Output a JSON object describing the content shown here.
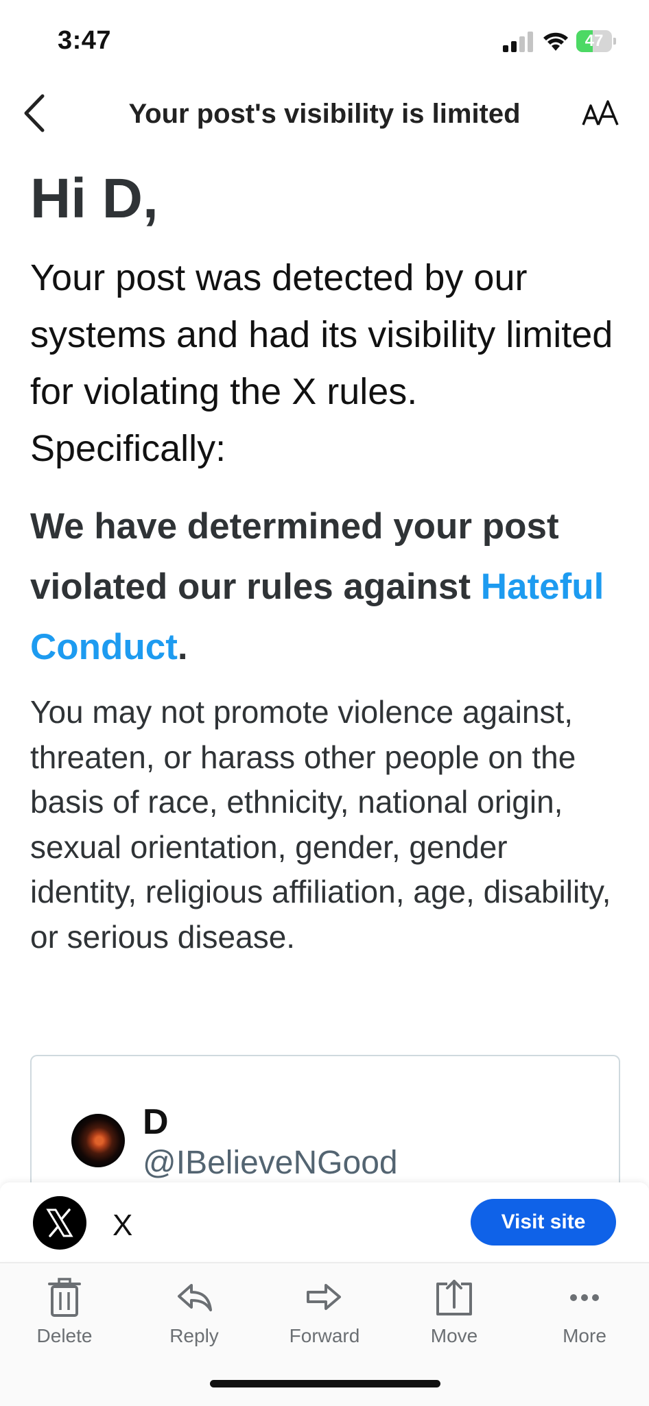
{
  "status_bar": {
    "time": "3:47",
    "battery": "47",
    "battery_level": 0.47
  },
  "header": {
    "title": "Your post's visibility is limited"
  },
  "message": {
    "greeting": "Hi D,",
    "intro": "Your post was detected by our systems and had its visibility limited for violating the X rules. Specifically:",
    "ruling_prefix": "We have determined your post violated our rules against ",
    "rule_link": "Hateful Conduct",
    "ruling_suffix": ".",
    "description": "You may not promote violence against, threaten, or harass other people on the basis of race, ethnicity, national origin, sexual orientation, gender, gender identity, religious affiliation, age, disability, or serious disease."
  },
  "post": {
    "name": "D",
    "handle": "@IBelieveNGood"
  },
  "sender": {
    "name": "X",
    "visit_label": "Visit site"
  },
  "toolbar": {
    "delete": "Delete",
    "reply": "Reply",
    "forward": "Forward",
    "move": "Move",
    "more": "More"
  },
  "colors": {
    "link": "#1d9bf0",
    "visit_button": "#0f62e8",
    "battery": "#4cd964"
  }
}
